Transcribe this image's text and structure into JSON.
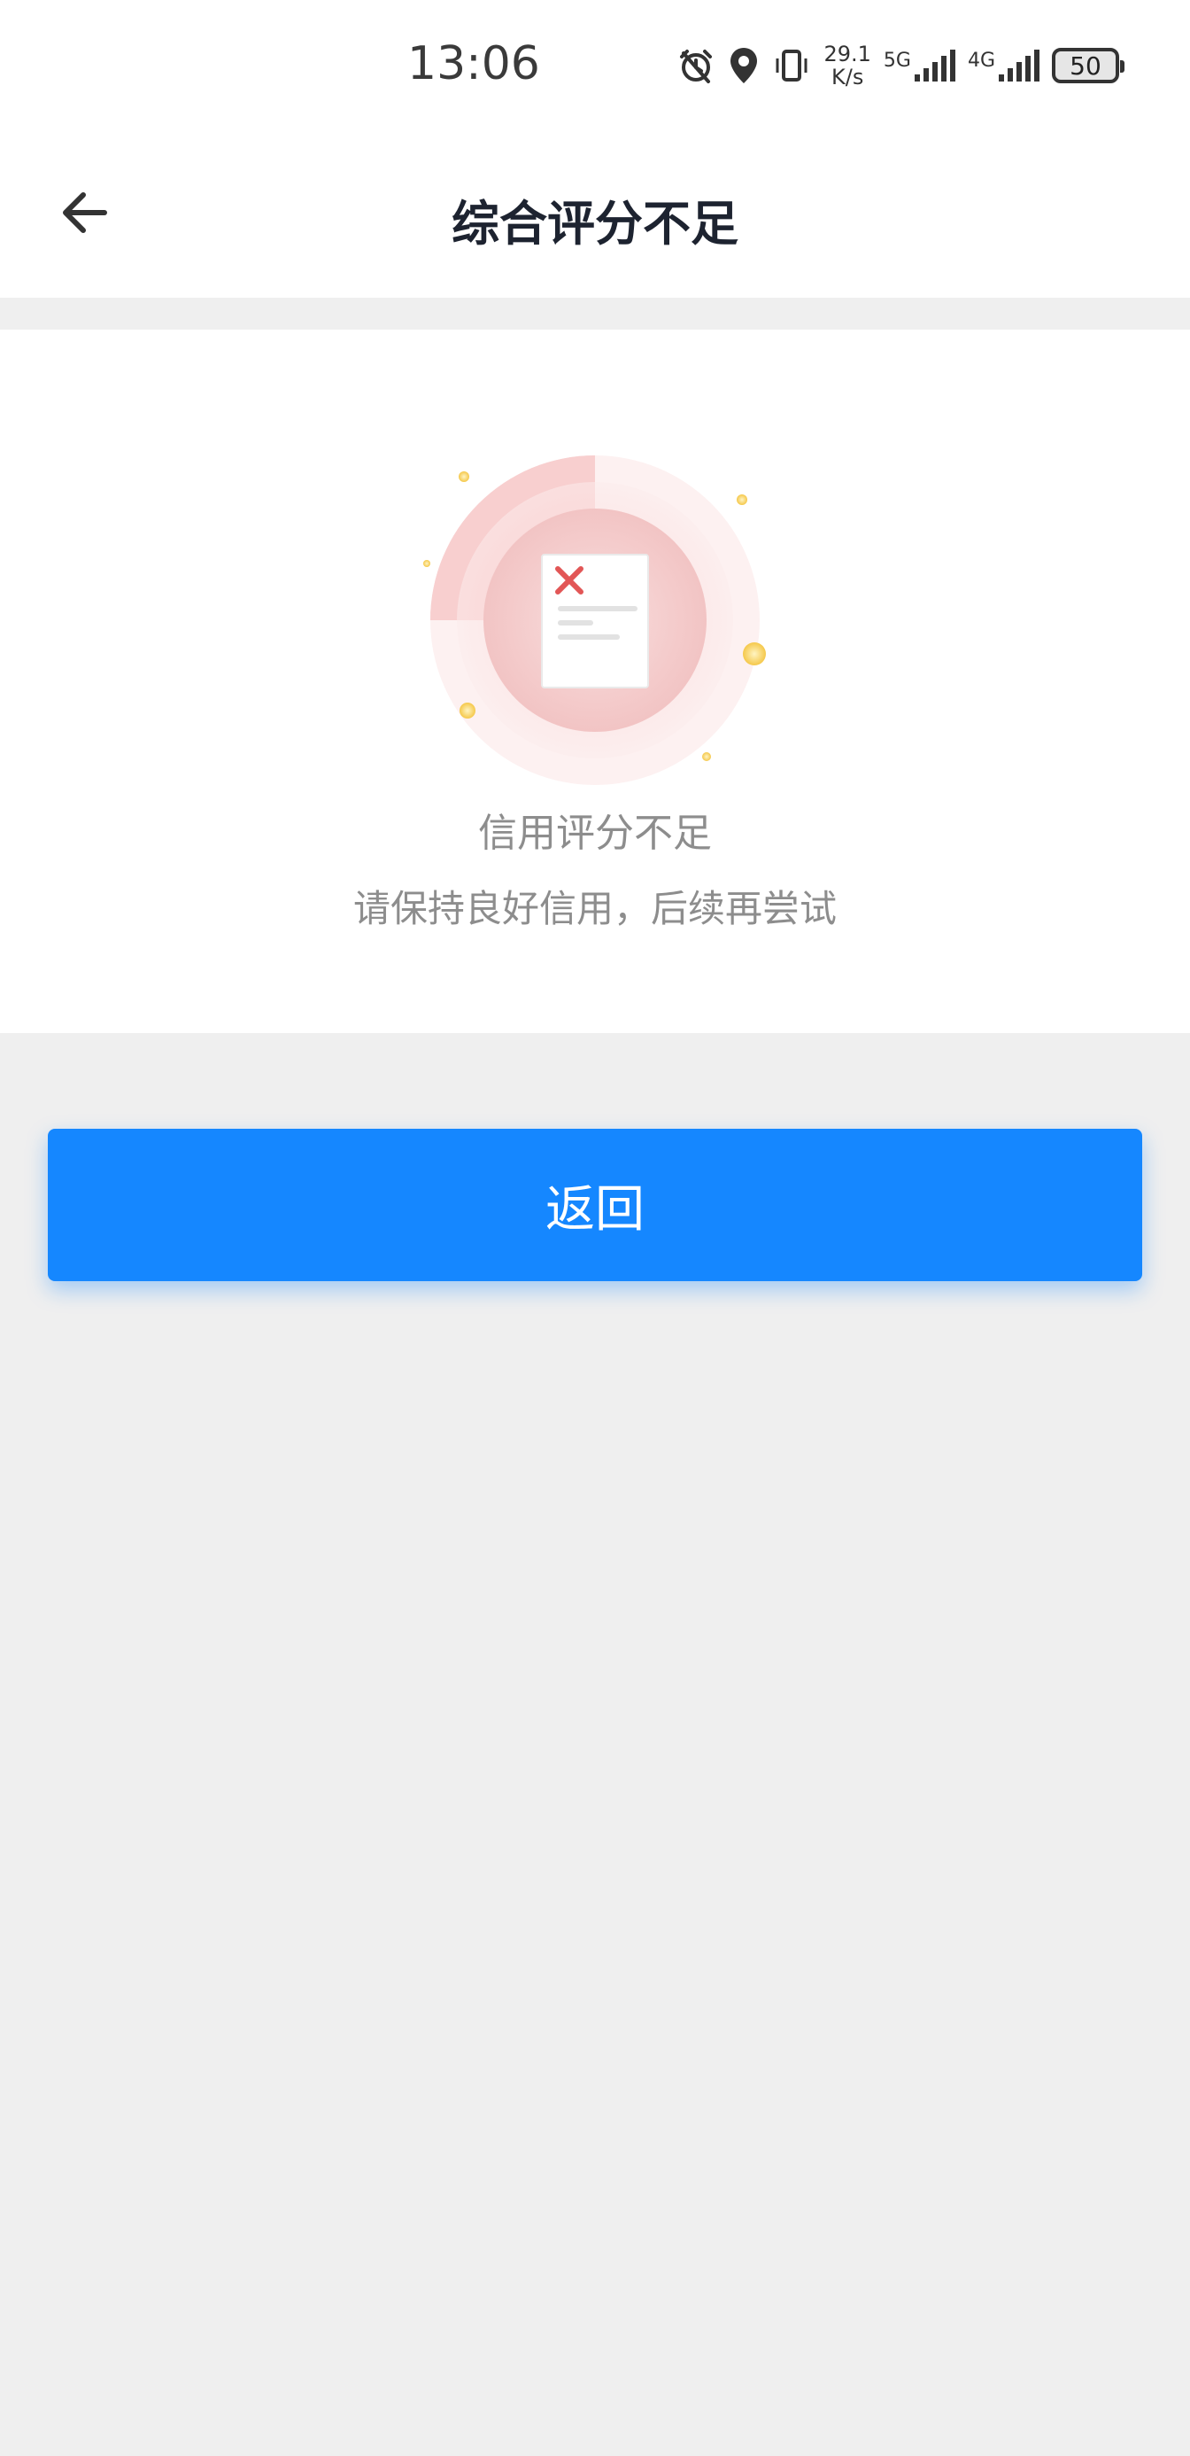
{
  "status_bar": {
    "time": "13:06",
    "net_speed_value": "29.1",
    "net_speed_unit": "K/s",
    "network_5g": "5G",
    "network_4g": "4G",
    "battery": "50"
  },
  "header": {
    "title": "综合评分不足"
  },
  "result": {
    "title": "信用评分不足",
    "subtitle": "请保持良好信用，后续再尝试"
  },
  "actions": {
    "return_label": "返回"
  },
  "colors": {
    "primary": "#1587ff",
    "error_red": "#e25656",
    "background": "#efefef"
  },
  "icons": {
    "back": "arrow-left-icon",
    "alarm": "alarm-icon",
    "location": "location-icon",
    "vibrate": "vibrate-icon",
    "signal": "signal-icon"
  }
}
